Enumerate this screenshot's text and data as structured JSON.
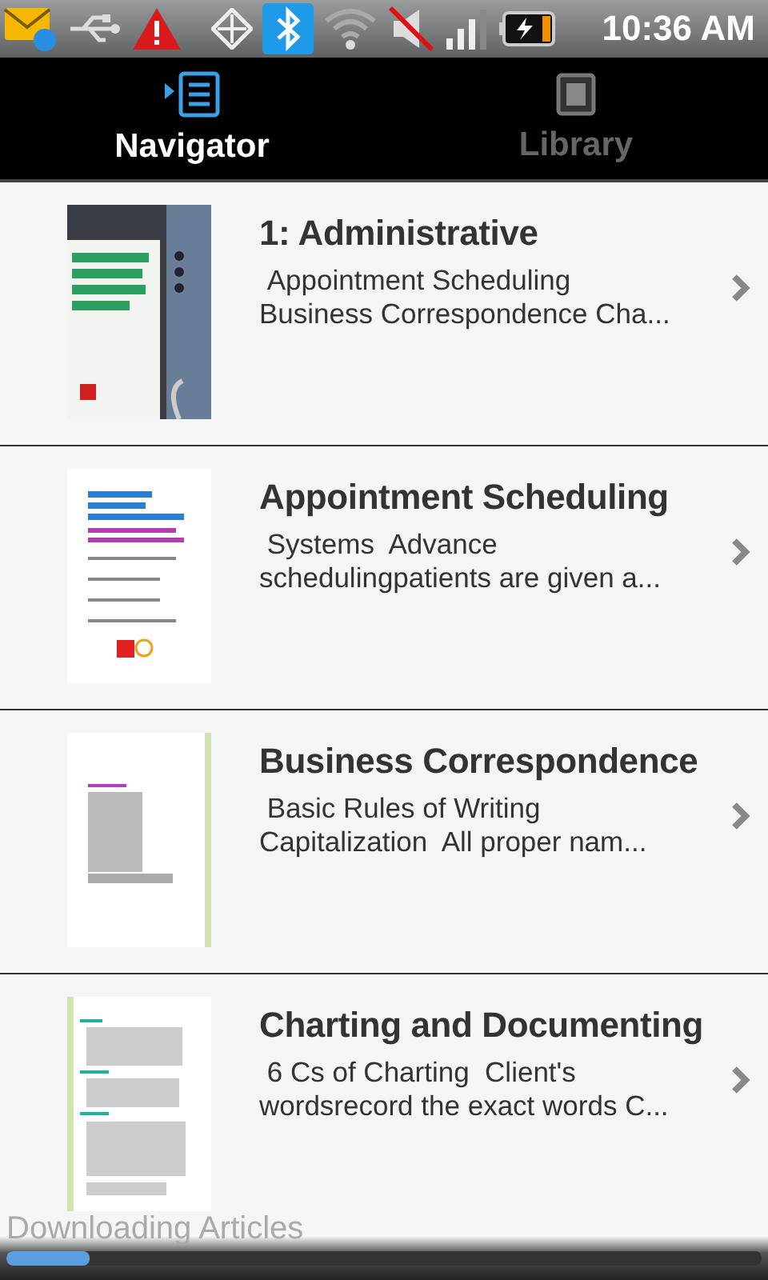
{
  "status_bar": {
    "time": "10:36 AM"
  },
  "tabs": [
    {
      "label": "Navigator",
      "kind": "navigator",
      "selected": true
    },
    {
      "label": "Library",
      "kind": "library",
      "selected": false
    }
  ],
  "articles": [
    {
      "title": "1: Administrative",
      "summary": " Appointment Scheduling\nBusiness Correspondence Cha..."
    },
    {
      "title": "Appointment Scheduling",
      "summary": " Systems  Advance\nschedulingpatients are given a..."
    },
    {
      "title": "Business Correspondence",
      "summary": " Basic Rules of Writing\nCapitalization  All proper nam..."
    },
    {
      "title": "Charting and Documenting",
      "summary": " 6 Cs of Charting  Client's\nwordsrecord the exact words C..."
    }
  ],
  "download": {
    "label": "Downloading Articles",
    "level": 0.11
  }
}
